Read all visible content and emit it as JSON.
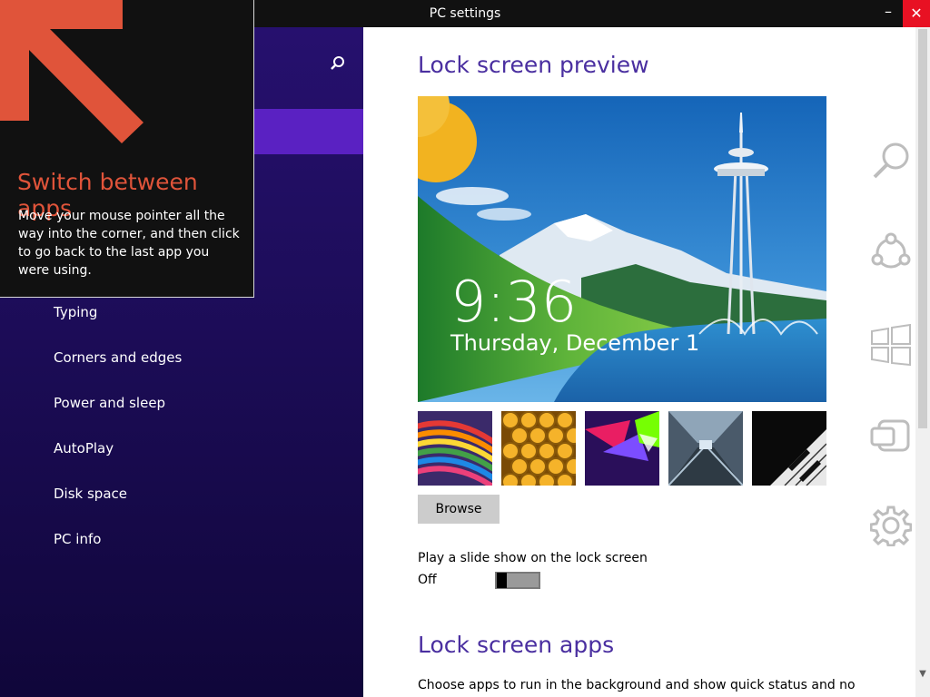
{
  "window": {
    "title": "PC settings",
    "minimize_glyph": "–",
    "close_glyph": "✕"
  },
  "nav": {
    "search_icon": "search-icon",
    "items": [
      {
        "label": "Typing"
      },
      {
        "label": "Corners and edges"
      },
      {
        "label": "Power and sleep"
      },
      {
        "label": "AutoPlay"
      },
      {
        "label": "Disk space"
      },
      {
        "label": "PC info"
      }
    ]
  },
  "tip": {
    "title": "Switch between apps",
    "body": "Move your mouse pointer all the way into the corner, and then click to go back to the last app you were using."
  },
  "content": {
    "lock_screen_preview_heading": "Lock screen preview",
    "preview_time": "9:36",
    "preview_date": "Thursday, December 1",
    "thumbnails": [
      "thumbnail-rainbow",
      "thumbnail-honeycomb",
      "thumbnail-abstract",
      "thumbnail-tunnel",
      "thumbnail-piano"
    ],
    "browse_label": "Browse",
    "slideshow_label": "Play a slide show on the lock screen",
    "slideshow_state": "Off",
    "lock_screen_apps_heading": "Lock screen apps",
    "apps_description": "Choose apps to run in the background and show quick status and notifications,"
  },
  "charms": [
    {
      "icon": "search-icon"
    },
    {
      "icon": "share-icon"
    },
    {
      "icon": "start-icon"
    },
    {
      "icon": "devices-icon"
    },
    {
      "icon": "settings-icon"
    }
  ],
  "colors": {
    "nav_background": "#1b0c55",
    "nav_selected": "#5a21c2",
    "heading": "#4a2fa0",
    "tip_accent": "#e0543a",
    "close_button": "#e81123"
  }
}
